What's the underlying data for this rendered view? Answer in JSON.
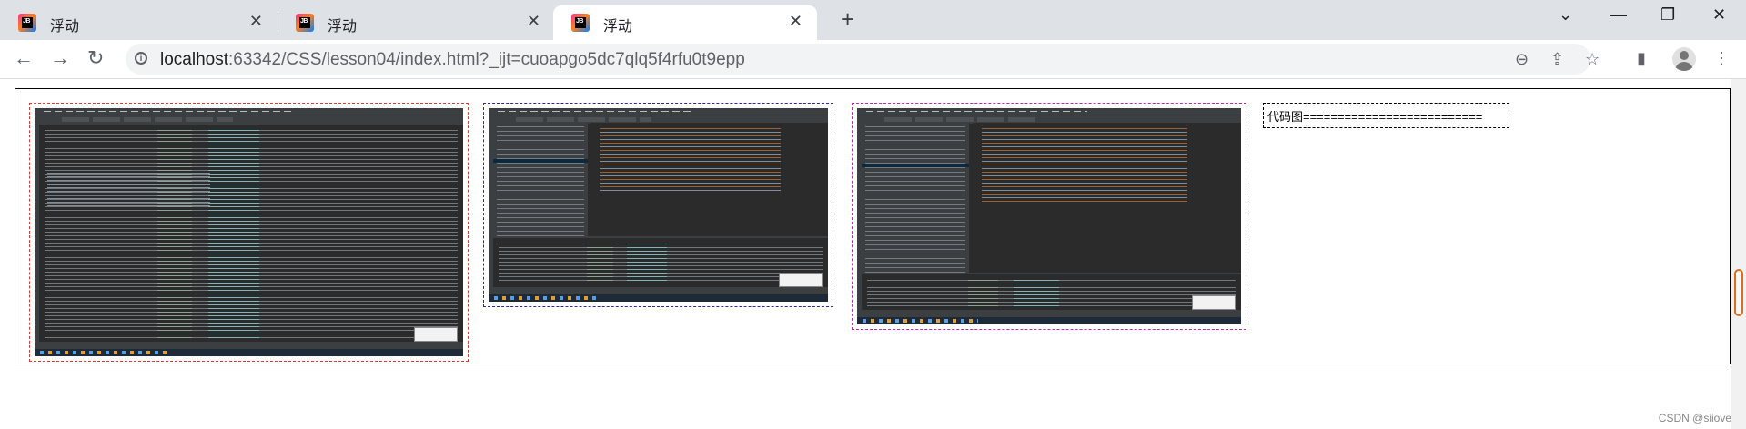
{
  "tabs": [
    {
      "title": "浮动",
      "favicon": "jetbrains-icon",
      "active": false
    },
    {
      "title": "浮动",
      "favicon": "jetbrains-icon",
      "active": false
    },
    {
      "title": "浮动",
      "favicon": "jetbrains-icon",
      "active": true
    }
  ],
  "favicon_text": "JB",
  "address": {
    "host": "localhost",
    "rest": ":63342/CSS/lesson04/index.html?_ijt=cuoapgo5dc7qlq5f4rfu0t9epp"
  },
  "icons": {
    "back": "arrow-left-icon",
    "forward": "arrow-right-icon",
    "reload": "reload-icon",
    "site_info": "info-icon",
    "zoom": "zoom-out-icon",
    "share": "share-icon",
    "bookmark": "star-icon",
    "side_panel": "side-panel-icon",
    "profile": "avatar-icon",
    "menu": "kebab-menu-icon"
  },
  "float_boxes": [
    {
      "kind": "image",
      "border_color": "#e53935",
      "alt": "IDE screenshot with Spring Boot console"
    },
    {
      "kind": "image",
      "border_color": "#2a2aa8",
      "alt": "IDE screenshot with application class"
    },
    {
      "kind": "image",
      "border_color": "#c02ab4",
      "alt": "IDE screenshot with controller class"
    },
    {
      "kind": "text",
      "border_color": "#000000",
      "text": "代码图=========================="
    }
  ],
  "watermark": "CSDN @siiove"
}
